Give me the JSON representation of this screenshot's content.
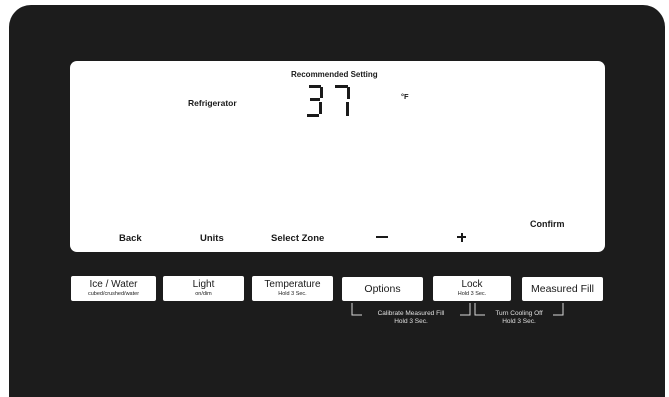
{
  "display": {
    "recommended_label": "Recommended Setting",
    "zone_label": "Refrigerator",
    "temperature": "37",
    "unit": "°F"
  },
  "softkeys": {
    "back": "Back",
    "units": "Units",
    "select_zone": "Select Zone",
    "minus": "−",
    "plus": "+",
    "confirm": "Confirm"
  },
  "buttons": {
    "ice_water": {
      "label": "Ice / Water",
      "sub": "cubed/crushed/water"
    },
    "light": {
      "label": "Light",
      "sub": "on/dim"
    },
    "temperature": {
      "label": "Temperature",
      "sub": "Hold 3 Sec."
    },
    "options": {
      "label": "Options"
    },
    "lock": {
      "label": "Lock",
      "sub": "Hold 3 Sec."
    },
    "measured_fill": {
      "label": "Measured Fill"
    }
  },
  "hold_functions": {
    "calibrate": {
      "label": "Calibrate Measured Fill",
      "sub": "Hold 3 Sec."
    },
    "cooling_off": {
      "label": "Turn Cooling Off",
      "sub": "Hold 3 Sec."
    }
  },
  "colors": {
    "panel": "#1c1c1c",
    "screen": "#ffffff",
    "text": "#1a1a1a"
  }
}
